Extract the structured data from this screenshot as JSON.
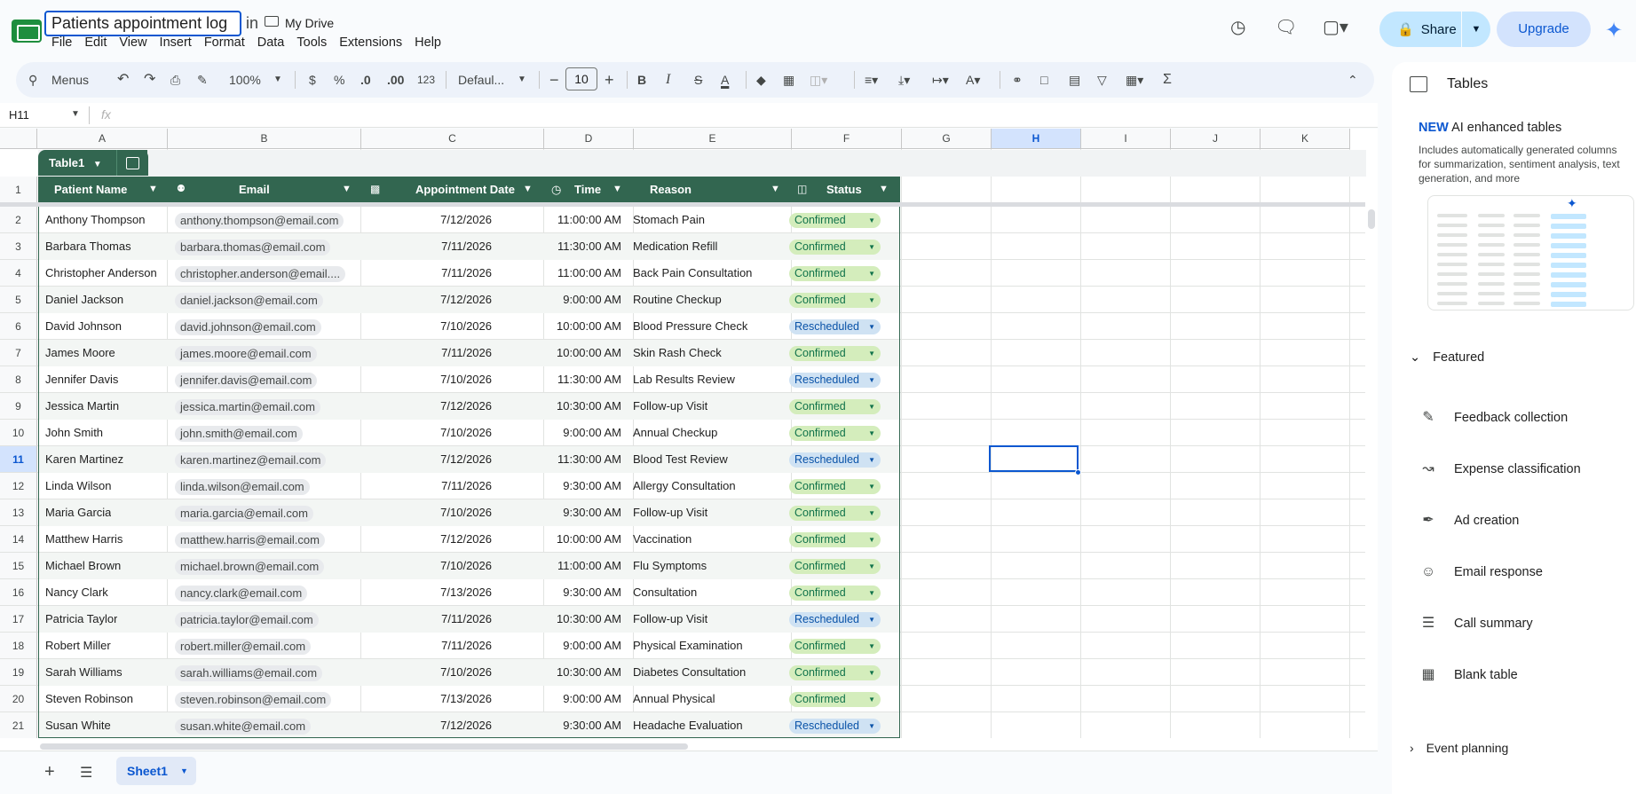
{
  "doc": {
    "title": "Patients appointment log",
    "in": "in",
    "location": "My Drive"
  },
  "menu": [
    "File",
    "Edit",
    "View",
    "Insert",
    "Format",
    "Data",
    "Tools",
    "Extensions",
    "Help"
  ],
  "header": {
    "share": "Share",
    "upgrade": "Upgrade"
  },
  "toolbar": {
    "search": "Menus",
    "zoom": "100%",
    "currency": "$",
    "percent": "%",
    "dec_less": ".0",
    "dec_more": ".00",
    "number_format": "123",
    "font": "Defaul...",
    "font_size": "10",
    "minus": "−",
    "plus": "+",
    "bold": "B",
    "italic": "I",
    "strike": "S",
    "text_color": "A"
  },
  "formula": {
    "cell": "H11",
    "fx": "fx"
  },
  "columns": [
    "A",
    "B",
    "C",
    "D",
    "E",
    "F",
    "G",
    "H",
    "I",
    "J",
    "K"
  ],
  "selected_column": "H",
  "rows": [
    "1",
    "2",
    "3",
    "4",
    "5",
    "6",
    "7",
    "8",
    "9",
    "10",
    "11",
    "12",
    "13",
    "14",
    "15",
    "16",
    "17",
    "18",
    "19",
    "20",
    "21"
  ],
  "selected_row": "11",
  "table": {
    "name": "Table1",
    "headers": [
      "Patient Name",
      "Email",
      "Appointment Date",
      "Time",
      "Reason",
      "Status"
    ],
    "records": [
      [
        "Anthony Thompson",
        "anthony.thompson@email.com",
        "7/12/2026",
        "11:00:00 AM",
        "Stomach Pain",
        "Confirmed"
      ],
      [
        "Barbara Thomas",
        "barbara.thomas@email.com",
        "7/11/2026",
        "11:30:00 AM",
        "Medication Refill",
        "Confirmed"
      ],
      [
        "Christopher Anderson",
        "christopher.anderson@email....",
        "7/11/2026",
        "11:00:00 AM",
        "Back Pain Consultation",
        "Confirmed"
      ],
      [
        "Daniel Jackson",
        "daniel.jackson@email.com",
        "7/12/2026",
        "9:00:00 AM",
        "Routine Checkup",
        "Confirmed"
      ],
      [
        "David Johnson",
        "david.johnson@email.com",
        "7/10/2026",
        "10:00:00 AM",
        "Blood Pressure Check",
        "Rescheduled"
      ],
      [
        "James Moore",
        "james.moore@email.com",
        "7/11/2026",
        "10:00:00 AM",
        "Skin Rash Check",
        "Confirmed"
      ],
      [
        "Jennifer Davis",
        "jennifer.davis@email.com",
        "7/10/2026",
        "11:30:00 AM",
        "Lab Results Review",
        "Rescheduled"
      ],
      [
        "Jessica Martin",
        "jessica.martin@email.com",
        "7/12/2026",
        "10:30:00 AM",
        "Follow-up Visit",
        "Confirmed"
      ],
      [
        "John Smith",
        "john.smith@email.com",
        "7/10/2026",
        "9:00:00 AM",
        "Annual Checkup",
        "Confirmed"
      ],
      [
        "Karen Martinez",
        "karen.martinez@email.com",
        "7/12/2026",
        "11:30:00 AM",
        "Blood Test Review",
        "Rescheduled"
      ],
      [
        "Linda Wilson",
        "linda.wilson@email.com",
        "7/11/2026",
        "9:30:00 AM",
        "Allergy Consultation",
        "Confirmed"
      ],
      [
        "Maria Garcia",
        "maria.garcia@email.com",
        "7/10/2026",
        "9:30:00 AM",
        "Follow-up Visit",
        "Confirmed"
      ],
      [
        "Matthew Harris",
        "matthew.harris@email.com",
        "7/12/2026",
        "10:00:00 AM",
        "Vaccination",
        "Confirmed"
      ],
      [
        "Michael Brown",
        "michael.brown@email.com",
        "7/10/2026",
        "11:00:00 AM",
        "Flu Symptoms",
        "Confirmed"
      ],
      [
        "Nancy Clark",
        "nancy.clark@email.com",
        "7/13/2026",
        "9:30:00 AM",
        "Consultation",
        "Confirmed"
      ],
      [
        "Patricia Taylor",
        "patricia.taylor@email.com",
        "7/11/2026",
        "10:30:00 AM",
        "Follow-up Visit",
        "Rescheduled"
      ],
      [
        "Robert Miller",
        "robert.miller@email.com",
        "7/11/2026",
        "9:00:00 AM",
        "Physical Examination",
        "Confirmed"
      ],
      [
        "Sarah Williams",
        "sarah.williams@email.com",
        "7/10/2026",
        "10:30:00 AM",
        "Diabetes Consultation",
        "Confirmed"
      ],
      [
        "Steven Robinson",
        "steven.robinson@email.com",
        "7/13/2026",
        "9:00:00 AM",
        "Annual Physical",
        "Confirmed"
      ],
      [
        "Susan White",
        "susan.white@email.com",
        "7/12/2026",
        "9:30:00 AM",
        "Headache Evaluation",
        "Rescheduled"
      ]
    ]
  },
  "sheets": {
    "active": "Sheet1"
  },
  "panel": {
    "title": "Tables",
    "new_tag": "NEW",
    "new_title": "AI enhanced tables",
    "desc": "Includes automatically generated columns for summarization, sentiment analysis, text generation, and more",
    "featured": "Featured",
    "items": [
      "Feedback collection",
      "Expense classification",
      "Ad creation",
      "Email response",
      "Call summary",
      "Blank table"
    ],
    "next_section": "Event planning"
  },
  "colors": {
    "table_green": "#326650",
    "confirmed_bg": "#d4edbc",
    "rescheduled_bg": "#cfe2f3",
    "accent": "#0b57d0"
  }
}
